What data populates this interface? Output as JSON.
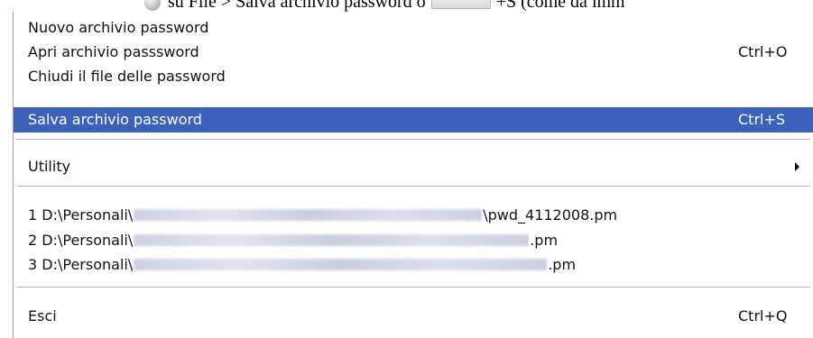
{
  "caption": {
    "text_before": "su File > Salva archivio password o",
    "text_after": "+S (come da imm"
  },
  "menu": {
    "items": [
      {
        "label": "Nuovo archivio password",
        "shortcut": ""
      },
      {
        "label": "Apri archivio passsword",
        "shortcut": "Ctrl+O"
      },
      {
        "label": "Chiudi il file delle password",
        "shortcut": ""
      },
      {
        "label": "Salva archivio password",
        "shortcut": "Ctrl+S",
        "highlighted": true
      },
      {
        "label": "Utility",
        "submenu": true
      },
      {
        "label": "Esci",
        "shortcut": "Ctrl+Q"
      }
    ],
    "recent_files": [
      {
        "prefix": "1 D:\\Personali\\",
        "suffix": "\\pwd_4112008.pm"
      },
      {
        "prefix": "2 D:\\Personali\\",
        "suffix": ".pm"
      },
      {
        "prefix": "3 D:\\Personali\\",
        "suffix": ".pm"
      }
    ]
  },
  "colors": {
    "highlight": "#3a62bd",
    "separator": "#b4b4b4"
  },
  "icons": {
    "caption_icon": "gray-circle-icon",
    "submenu_arrow": "chevron-right-icon"
  }
}
